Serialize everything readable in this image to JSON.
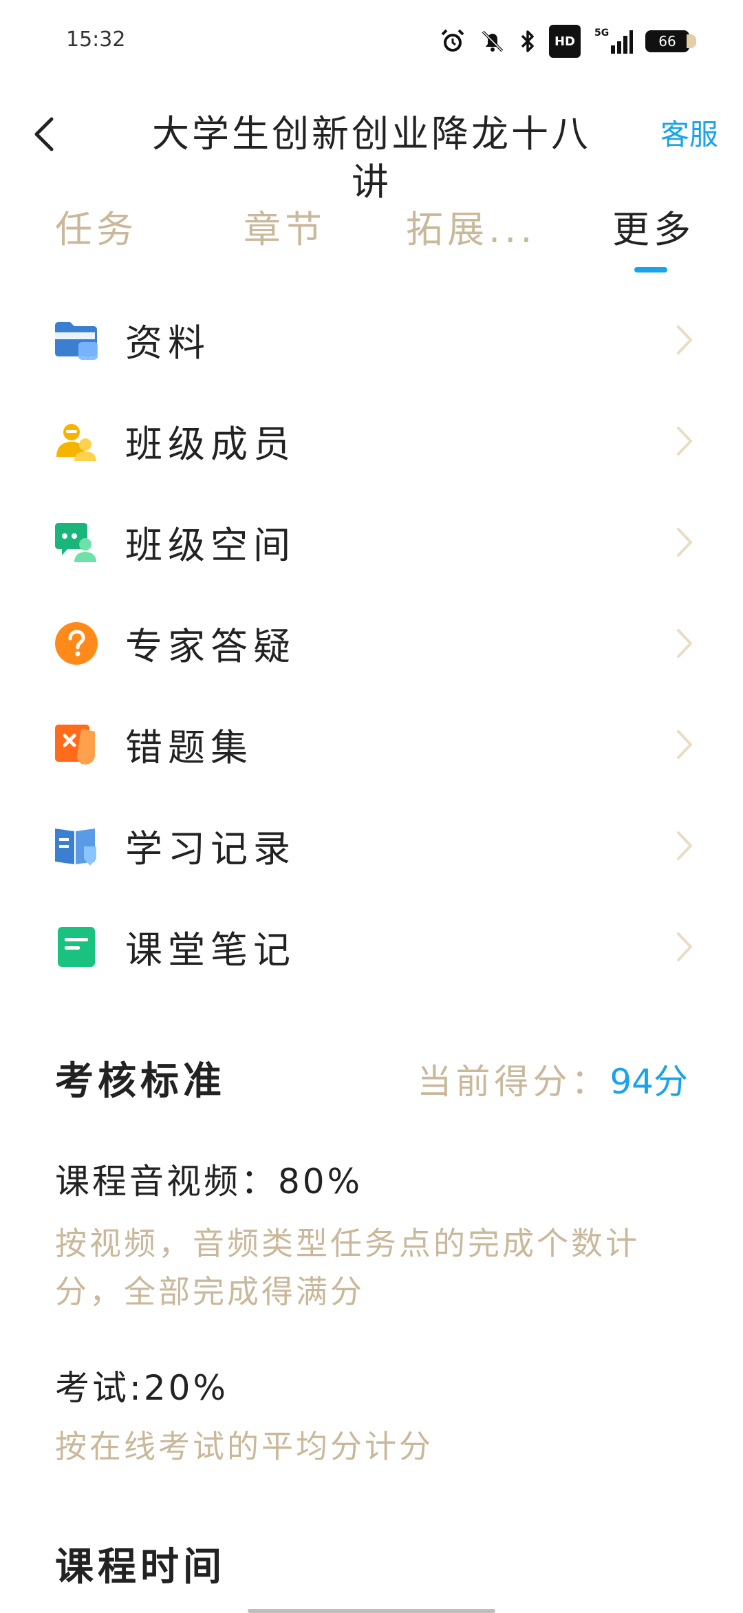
{
  "status_bar": {
    "time": "15:32",
    "network": "5G",
    "hd": "HD",
    "battery": "66"
  },
  "header": {
    "title": "大学生创新创业降龙十八讲",
    "service": "客服"
  },
  "tabs": [
    {
      "label": "任务"
    },
    {
      "label": "章节"
    },
    {
      "label": "拓展..."
    },
    {
      "label": "更多"
    }
  ],
  "menu": [
    {
      "label": "资料",
      "icon": "folder-icon"
    },
    {
      "label": "班级成员",
      "icon": "class-members-icon"
    },
    {
      "label": "班级空间",
      "icon": "chat-icon"
    },
    {
      "label": "专家答疑",
      "icon": "question-icon"
    },
    {
      "label": "错题集",
      "icon": "wrong-questions-icon"
    },
    {
      "label": "学习记录",
      "icon": "study-record-icon"
    },
    {
      "label": "课堂笔记",
      "icon": "note-icon"
    }
  ],
  "assessment": {
    "title": "考核标准",
    "score_label": "当前得分：",
    "score_value": "94分",
    "items": [
      {
        "title": "课程音视频：80%",
        "desc": "按视频，音频类型任务点的完成个数计分，全部完成得满分"
      },
      {
        "title": "考试:20%",
        "desc": "按在线考试的平均分计分"
      }
    ]
  },
  "course_time": {
    "title": "课程时间"
  }
}
